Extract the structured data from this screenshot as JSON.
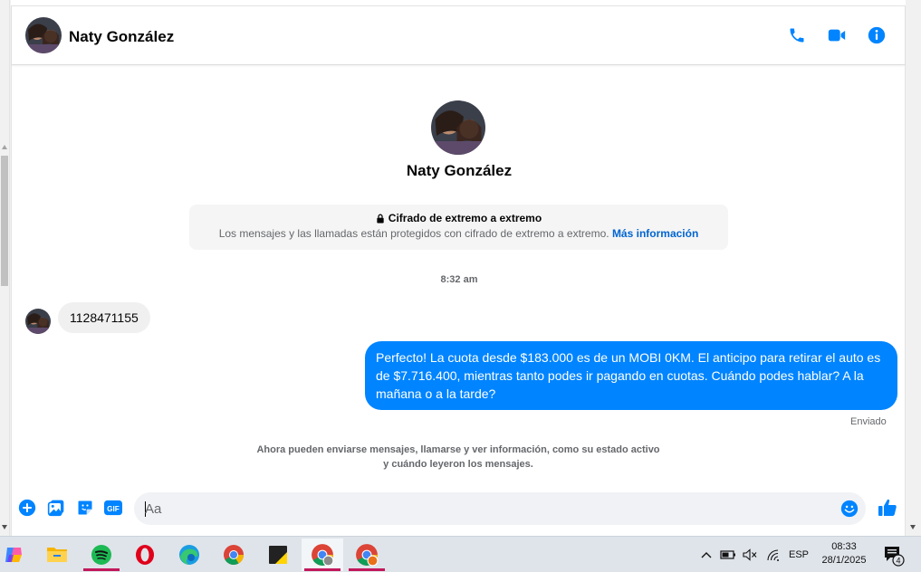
{
  "conversation": {
    "contact_name": "Naty González",
    "colors": {
      "accent": "#0084ff",
      "link": "#0064d1"
    }
  },
  "header": {
    "call_icon": "phone-icon",
    "video_icon": "video-camera-icon",
    "info_icon": "info-icon"
  },
  "e2e": {
    "title": "Cifrado de extremo a extremo",
    "description": "Los mensajes y las llamadas están protegidos con cifrado de extremo a extremo.",
    "link": "Más información"
  },
  "thread": {
    "timestamp": "8:32 am",
    "incoming_message": "1128471155",
    "outgoing_message": "Perfecto! La cuota desde $183.000 es de un MOBI 0KM. El anticipo para retirar el auto es de $7.716.400, mientras tanto podes ir pagando en cuotas. Cuándo podes hablar? A la mañana o a la tarde?",
    "status": "Enviado",
    "notice": "Ahora pueden enviarse mensajes, llamarse y ver información, como su estado activo y cuándo leyeron los mensajes."
  },
  "composer": {
    "placeholder": "Aa",
    "value": "",
    "gif_label": "GIF"
  },
  "taskbar": {
    "apps": [
      "copilot-icon",
      "file-explorer-icon",
      "spotify-icon",
      "opera-icon",
      "edge-icon",
      "chrome-icon",
      "sticky-notes-icon",
      "chrome-profile-icon",
      "chrome-profile-2-icon"
    ],
    "language": "ESP",
    "time": "08:33",
    "date": "28/1/2025",
    "notification_count": "4"
  }
}
